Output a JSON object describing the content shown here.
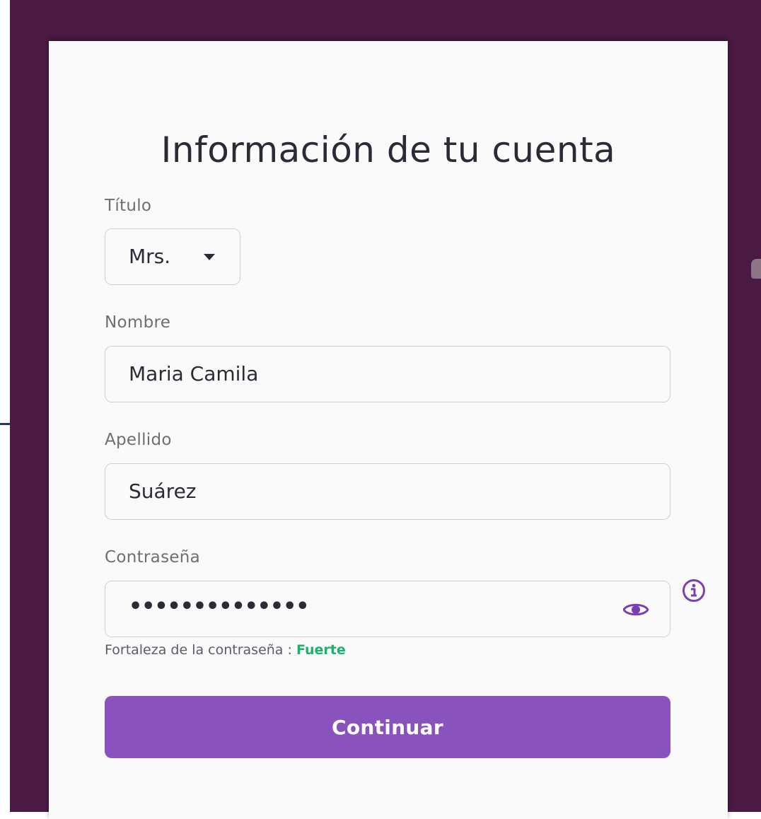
{
  "form": {
    "title": "Información de tu cuenta",
    "titulo": {
      "label": "Título",
      "value": "Mrs."
    },
    "nombre": {
      "label": "Nombre",
      "value": "Maria Camila"
    },
    "apellido": {
      "label": "Apellido",
      "value": "Suárez"
    },
    "password": {
      "label": "Contraseña",
      "masked_value": "••••••••••••••",
      "strength_label": "Fortaleza de la contraseña :",
      "strength_value": "Fuerte"
    },
    "submit_label": "Continuar"
  },
  "icons": {
    "caret": "chevron-down-icon",
    "eye": "eye-icon",
    "info": "info-icon"
  },
  "colors": {
    "backdrop": "#4a1a43",
    "card": "#fafafa",
    "accent": "#8a52bd",
    "strength": "#19b36b",
    "text": "#2b2b36"
  }
}
